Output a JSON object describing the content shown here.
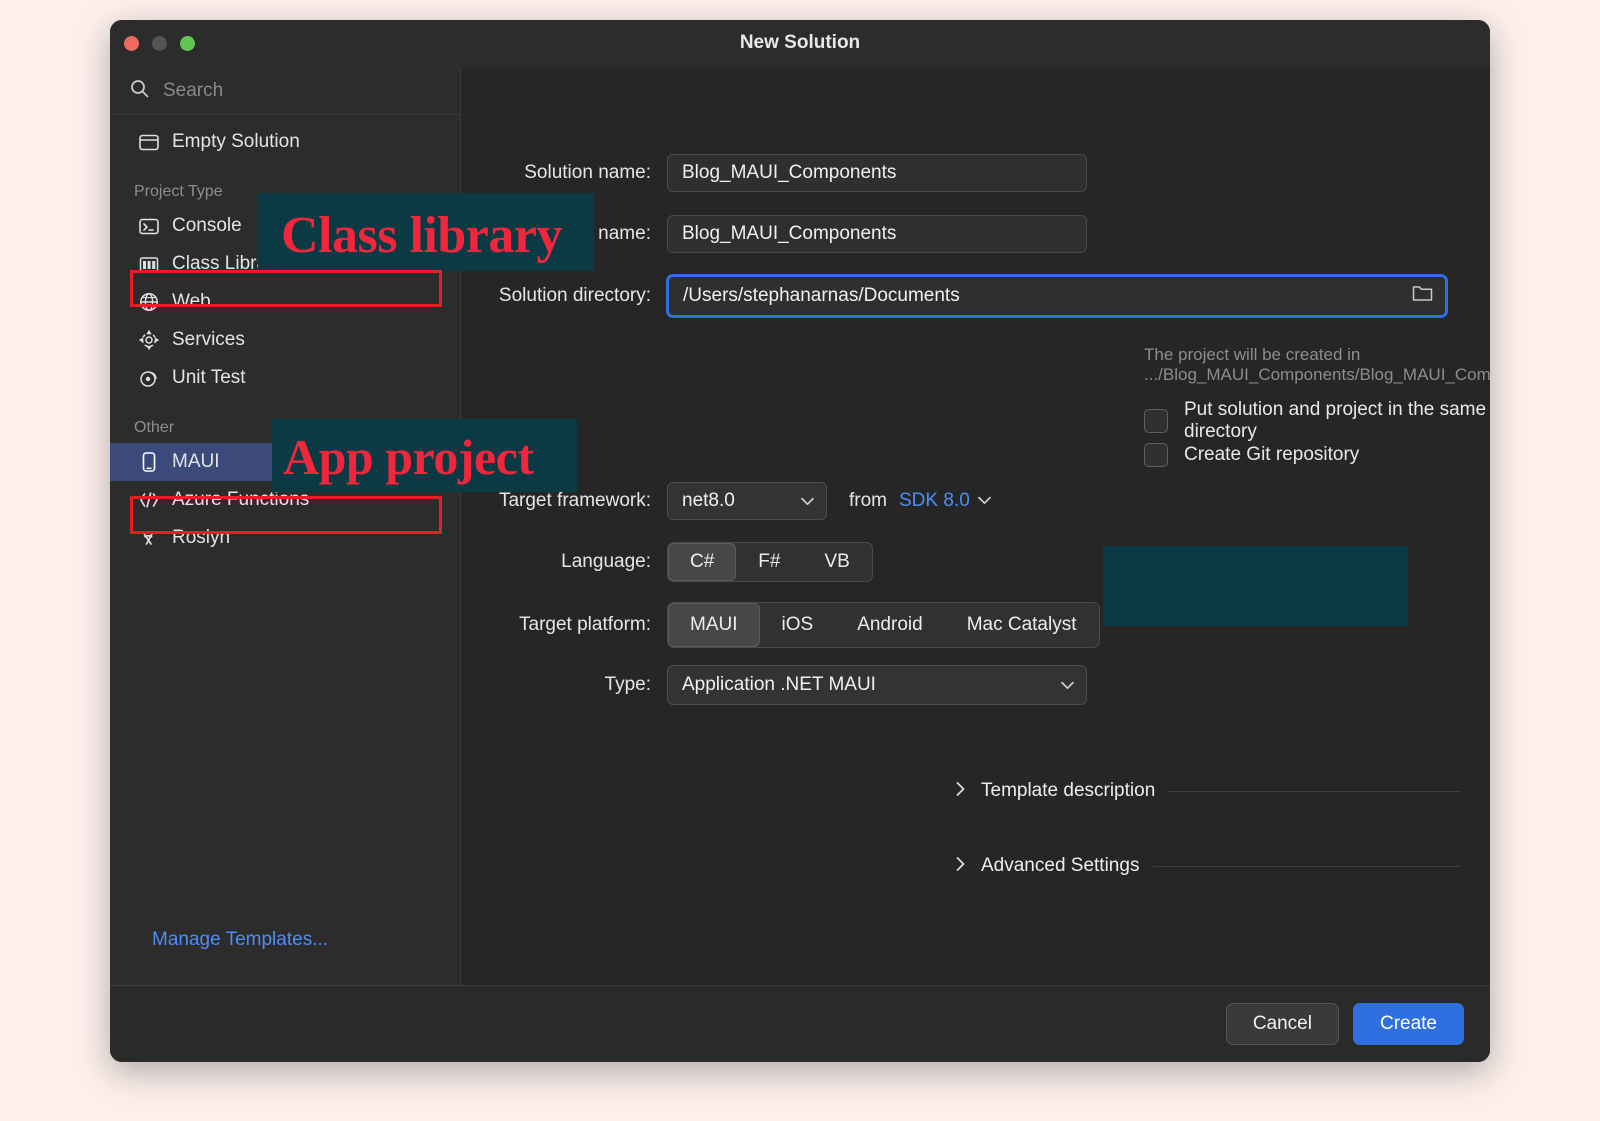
{
  "window": {
    "title": "New Solution",
    "traffic_lights": [
      "close",
      "minimize",
      "maximize"
    ]
  },
  "sidebar": {
    "search": {
      "placeholder": "Search",
      "value": ""
    },
    "items": [
      {
        "label": "Empty Solution",
        "icon": "window-icon",
        "selected": false
      },
      {
        "label": "Console",
        "icon": "terminal-icon",
        "selected": false
      },
      {
        "label": "Class Library",
        "icon": "library-icon",
        "selected": false
      },
      {
        "label": "Web",
        "icon": "globe-icon",
        "selected": false
      },
      {
        "label": "Services",
        "icon": "gear-icon",
        "selected": false
      },
      {
        "label": "Unit Test",
        "icon": "test-icon",
        "selected": false
      },
      {
        "label": "MAUI",
        "icon": "phone-icon",
        "selected": true
      },
      {
        "label": "Azure Functions",
        "icon": "azure-functions-icon",
        "selected": false
      },
      {
        "label": "Roslyn",
        "icon": "roslyn-icon",
        "selected": false
      }
    ],
    "groups": {
      "project_type": "Project Type",
      "other": "Other"
    },
    "manage_templates": "Manage Templates..."
  },
  "form": {
    "solution_name": {
      "label": "Solution name:",
      "value": "Blog_MAUI_Components"
    },
    "project_name": {
      "label": "Project name:",
      "value": "Blog_MAUI_Components"
    },
    "location": {
      "label": "Solution directory:",
      "value": "/Users/stephanarnas/Documents",
      "browse_icon": "folder-icon"
    },
    "hint": "The project will be created in .../Blog_MAUI_Components/Blog_MAUI_Components",
    "checkbox_same_dir": {
      "label": "Put solution and project in the same directory",
      "checked": false
    },
    "checkbox_git": {
      "label": "Create Git repository",
      "checked": false
    },
    "target_framework": {
      "label": "Target framework:",
      "value": "net8.0",
      "from_label": "from",
      "sdk_value": "SDK 8.0",
      "sdk_color": "#4c8ef7"
    },
    "language": {
      "label": "Language:",
      "options": [
        "C#",
        "F#",
        "VB"
      ],
      "selected": "C#"
    },
    "target_platform": {
      "label": "Target platform:",
      "options": [
        "MAUI",
        "iOS",
        "Android",
        "Mac Catalyst"
      ],
      "selected": "MAUI"
    },
    "type": {
      "label": "Type:",
      "value": "Application .NET MAUI"
    },
    "template_description": "Template description",
    "advanced_settings": "Advanced Settings"
  },
  "footer": {
    "cancel": "Cancel",
    "create": "Create",
    "create_color": "#2f6fe0"
  },
  "annotations": [
    {
      "text": "Class library",
      "color": "#f0263c"
    },
    {
      "text": "App project",
      "color": "#f0263c"
    }
  ]
}
